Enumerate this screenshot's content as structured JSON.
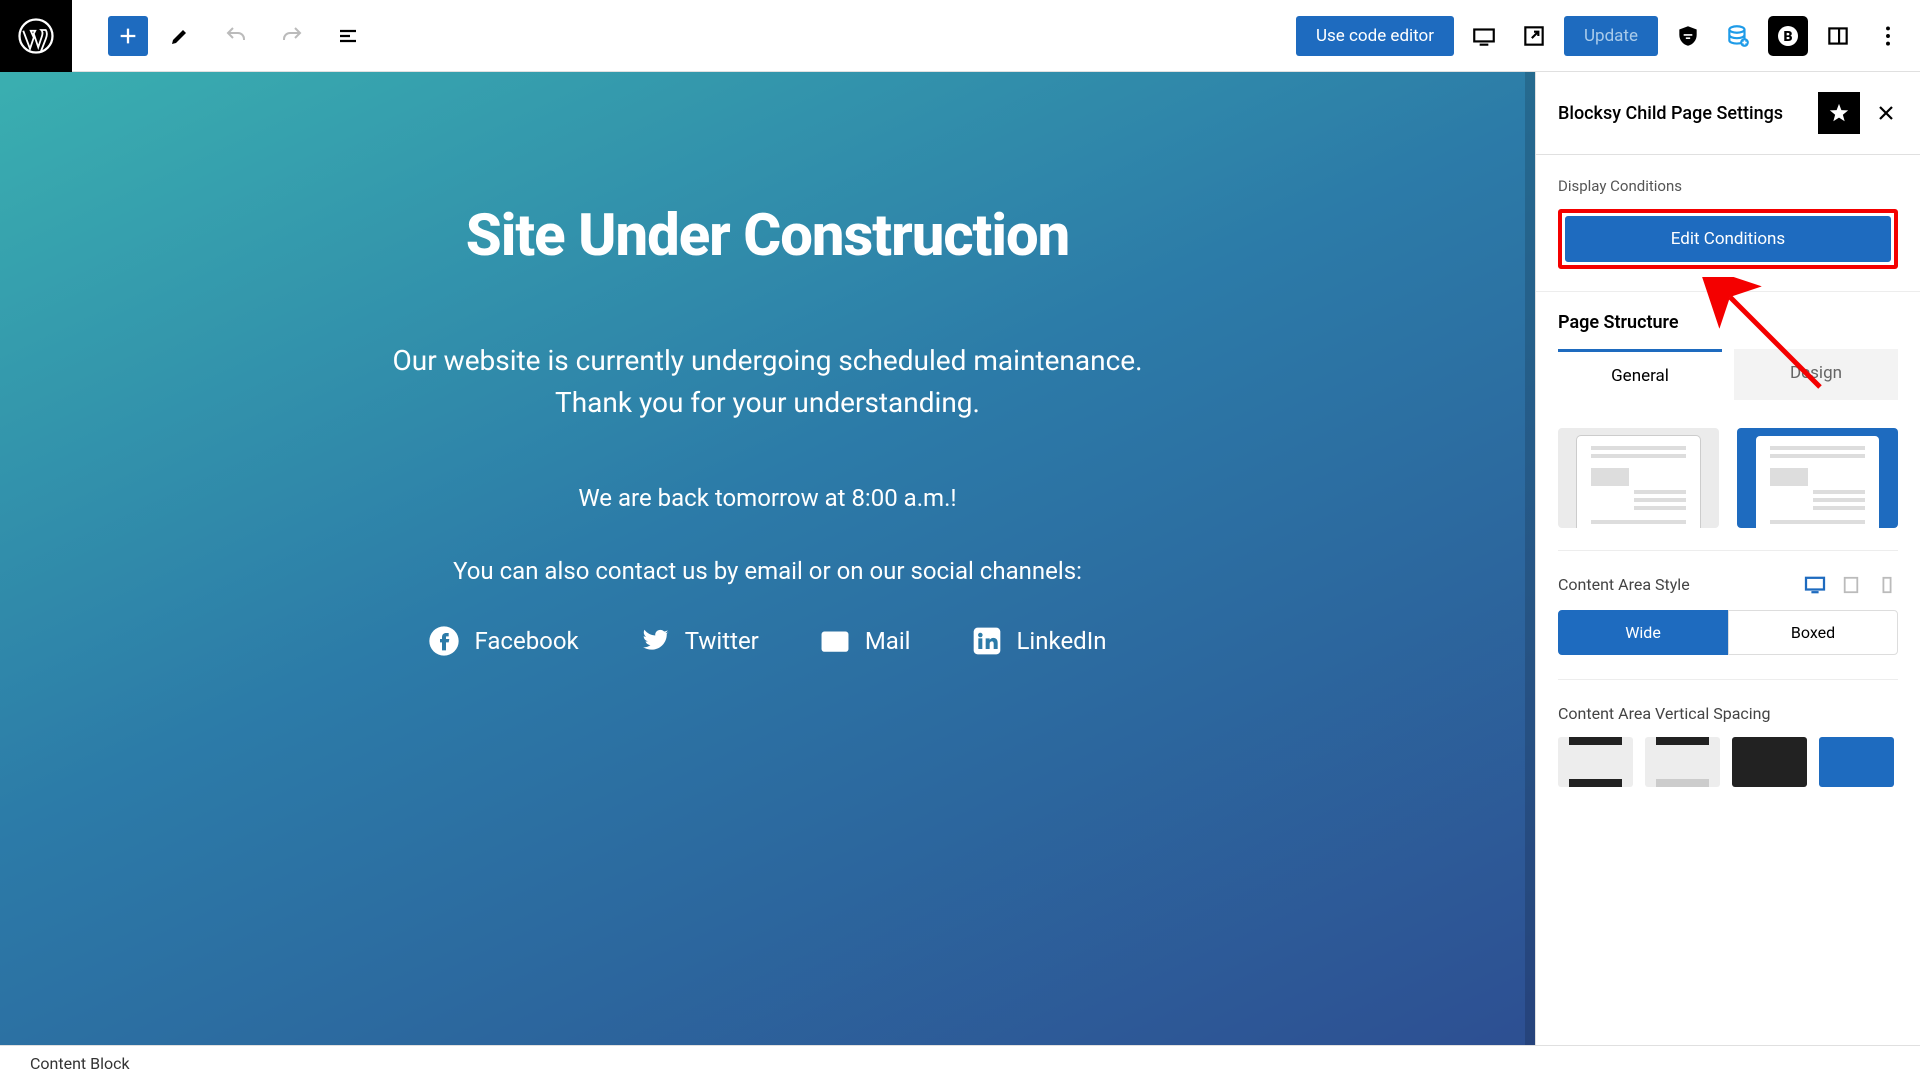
{
  "toolbar": {
    "code_editor_label": "Use code editor",
    "update_label": "Update"
  },
  "canvas": {
    "title": "Site Under Construction",
    "subtitle_line1": "Our website is currently undergoing scheduled maintenance.",
    "subtitle_line2": "Thank you for your understanding.",
    "back_text": "We are back tomorrow at 8:00 a.m.!",
    "contact_text": "You can also contact us by email or on our social channels:",
    "socials": [
      {
        "label": "Facebook"
      },
      {
        "label": "Twitter"
      },
      {
        "label": "Mail"
      },
      {
        "label": "LinkedIn"
      }
    ]
  },
  "sidebar": {
    "title": "Blocksy Child Page Settings",
    "display_conditions_label": "Display Conditions",
    "edit_conditions_label": "Edit Conditions",
    "page_structure_label": "Page Structure",
    "tabs": {
      "general": "General",
      "design": "Design"
    },
    "content_area_style_label": "Content Area Style",
    "wide_label": "Wide",
    "boxed_label": "Boxed",
    "vertical_spacing_label": "Content Area Vertical Spacing"
  },
  "footer": {
    "breadcrumb": "Content Block"
  },
  "colors": {
    "accent": "#1e6bbf",
    "highlight_border": "#f40000"
  }
}
